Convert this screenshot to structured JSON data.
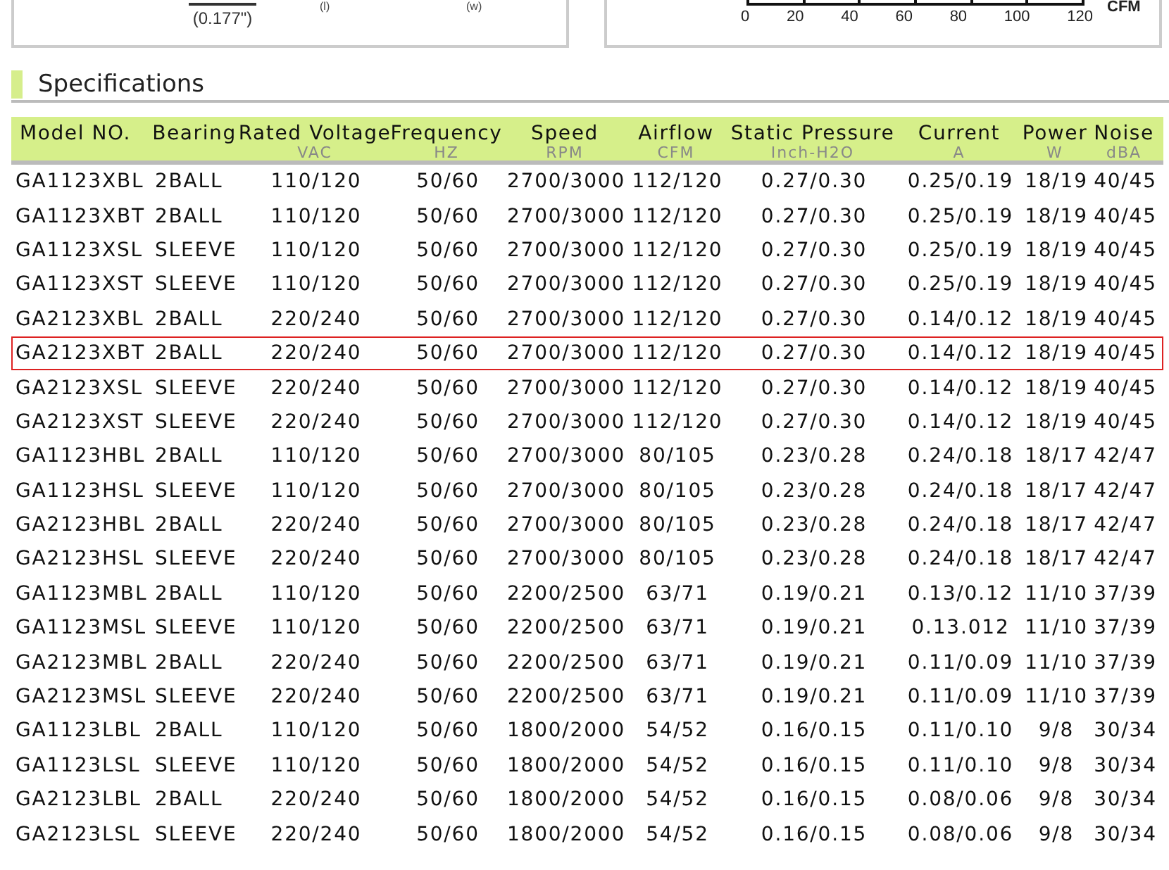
{
  "dimension_panel": {
    "dimension": "(0.177\")",
    "labels": [
      "(l)",
      "(w)"
    ]
  },
  "airflow_panel": {
    "axis_ticks": [
      "0",
      "20",
      "40",
      "60",
      "80",
      "100",
      "120"
    ],
    "axis_unit": "CFM"
  },
  "section_title": "Specifications",
  "table": {
    "columns": [
      {
        "name": "Model NO."
      },
      {
        "name": "Bearing"
      },
      {
        "name": "Rated Voltage",
        "unit": "VAC"
      },
      {
        "name": "Frequency",
        "unit": "HZ"
      },
      {
        "name": "Speed",
        "unit": "RPM"
      },
      {
        "name": "Airflow",
        "unit": "CFM"
      },
      {
        "name": "Static Pressure",
        "unit": "Inch-H2O"
      },
      {
        "name": "Current",
        "unit": "A"
      },
      {
        "name": "Power",
        "unit": "W"
      },
      {
        "name": "Noise",
        "unit": "dBA"
      }
    ],
    "rows": [
      {
        "selected": false,
        "cells": [
          "GA1123XBL",
          "2BALL",
          "110/120",
          "50/60",
          "2700/3000",
          "112/120",
          "0.27/0.30",
          "0.25/0.19",
          "18/19",
          "40/45"
        ]
      },
      {
        "selected": false,
        "cells": [
          "GA1123XBT",
          "2BALL",
          "110/120",
          "50/60",
          "2700/3000",
          "112/120",
          "0.27/0.30",
          "0.25/0.19",
          "18/19",
          "40/45"
        ]
      },
      {
        "selected": false,
        "cells": [
          "GA1123XSL",
          "SLEEVE",
          "110/120",
          "50/60",
          "2700/3000",
          "112/120",
          "0.27/0.30",
          "0.25/0.19",
          "18/19",
          "40/45"
        ]
      },
      {
        "selected": false,
        "cells": [
          "GA1123XST",
          "SLEEVE",
          "110/120",
          "50/60",
          "2700/3000",
          "112/120",
          "0.27/0.30",
          "0.25/0.19",
          "18/19",
          "40/45"
        ]
      },
      {
        "selected": false,
        "cells": [
          "GA2123XBL",
          "2BALL",
          "220/240",
          "50/60",
          "2700/3000",
          "112/120",
          "0.27/0.30",
          "0.14/0.12",
          "18/19",
          "40/45"
        ]
      },
      {
        "selected": true,
        "cells": [
          "GA2123XBT",
          "2BALL",
          "220/240",
          "50/60",
          "2700/3000",
          "112/120",
          "0.27/0.30",
          "0.14/0.12",
          "18/19",
          "40/45"
        ]
      },
      {
        "selected": false,
        "cells": [
          "GA2123XSL",
          "SLEEVE",
          "220/240",
          "50/60",
          "2700/3000",
          "112/120",
          "0.27/0.30",
          "0.14/0.12",
          "18/19",
          "40/45"
        ]
      },
      {
        "selected": false,
        "cells": [
          "GA2123XST",
          "SLEEVE",
          "220/240",
          "50/60",
          "2700/3000",
          "112/120",
          "0.27/0.30",
          "0.14/0.12",
          "18/19",
          "40/45"
        ]
      },
      {
        "selected": false,
        "cells": [
          "GA1123HBL",
          "2BALL",
          "110/120",
          "50/60",
          "2700/3000",
          "80/105",
          "0.23/0.28",
          "0.24/0.18",
          "18/17",
          "42/47"
        ]
      },
      {
        "selected": false,
        "cells": [
          "GA1123HSL",
          "SLEEVE",
          "110/120",
          "50/60",
          "2700/3000",
          "80/105",
          "0.23/0.28",
          "0.24/0.18",
          "18/17",
          "42/47"
        ]
      },
      {
        "selected": false,
        "cells": [
          "GA2123HBL",
          "2BALL",
          "220/240",
          "50/60",
          "2700/3000",
          "80/105",
          "0.23/0.28",
          "0.24/0.18",
          "18/17",
          "42/47"
        ]
      },
      {
        "selected": false,
        "cells": [
          "GA2123HSL",
          "SLEEVE",
          "220/240",
          "50/60",
          "2700/3000",
          "80/105",
          "0.23/0.28",
          "0.24/0.18",
          "18/17",
          "42/47"
        ]
      },
      {
        "selected": false,
        "cells": [
          "GA1123MBL",
          "2BALL",
          "110/120",
          "50/60",
          "2200/2500",
          "63/71",
          "0.19/0.21",
          "0.13/0.12",
          "11/10",
          "37/39"
        ]
      },
      {
        "selected": false,
        "cells": [
          "GA1123MSL",
          "SLEEVE",
          "110/120",
          "50/60",
          "2200/2500",
          "63/71",
          "0.19/0.21",
          "0.13.012",
          "11/10",
          "37/39"
        ]
      },
      {
        "selected": false,
        "cells": [
          "GA2123MBL",
          "2BALL",
          "220/240",
          "50/60",
          "2200/2500",
          "63/71",
          "0.19/0.21",
          "0.11/0.09",
          "11/10",
          "37/39"
        ]
      },
      {
        "selected": false,
        "cells": [
          "GA2123MSL",
          "SLEEVE",
          "220/240",
          "50/60",
          "2200/2500",
          "63/71",
          "0.19/0.21",
          "0.11/0.09",
          "11/10",
          "37/39"
        ]
      },
      {
        "selected": false,
        "cells": [
          "GA1123LBL",
          "2BALL",
          "110/120",
          "50/60",
          "1800/2000",
          "54/52",
          "0.16/0.15",
          "0.11/0.10",
          "9/8",
          "30/34"
        ]
      },
      {
        "selected": false,
        "cells": [
          "GA1123LSL",
          "SLEEVE",
          "110/120",
          "50/60",
          "1800/2000",
          "54/52",
          "0.16/0.15",
          "0.11/0.10",
          "9/8",
          "30/34"
        ]
      },
      {
        "selected": false,
        "cells": [
          "GA2123LBL",
          "2BALL",
          "220/240",
          "50/60",
          "1800/2000",
          "54/52",
          "0.16/0.15",
          "0.08/0.06",
          "9/8",
          "30/34"
        ]
      },
      {
        "selected": false,
        "cells": [
          "GA2123LSL",
          "SLEEVE",
          "220/240",
          "50/60",
          "1800/2000",
          "54/52",
          "0.16/0.15",
          "0.08/0.06",
          "9/8",
          "30/34"
        ]
      }
    ]
  }
}
